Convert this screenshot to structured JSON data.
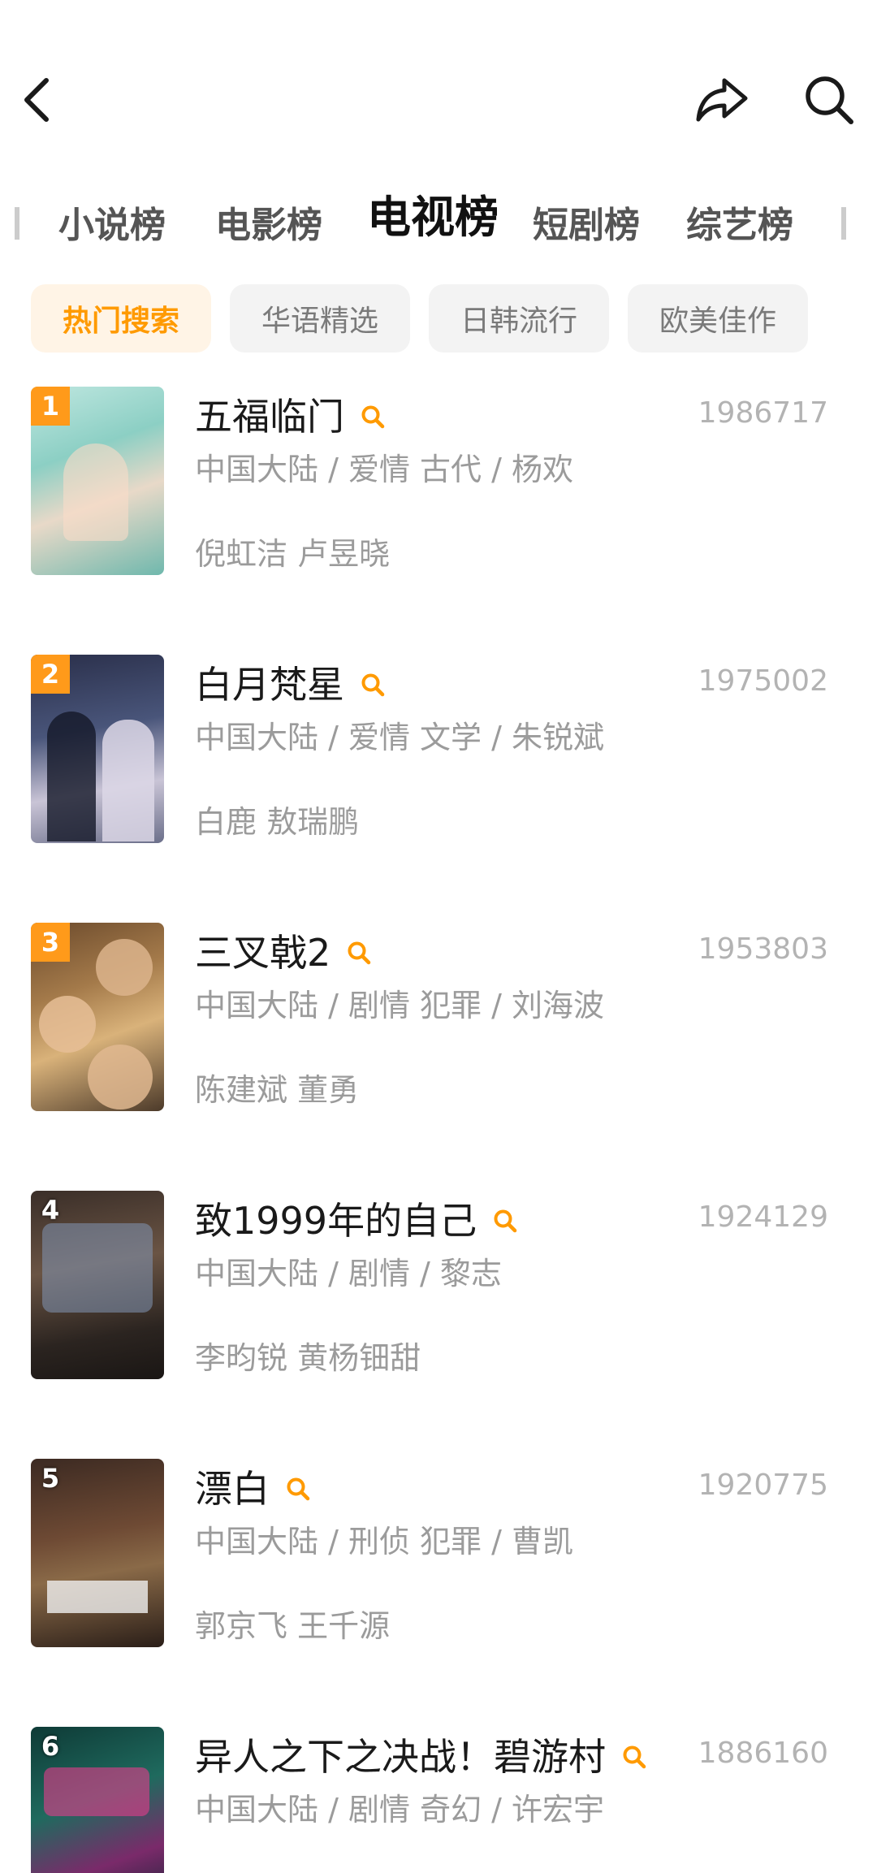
{
  "header": {
    "back_icon": "chevron-left-icon",
    "share_icon": "share-icon",
    "search_icon": "search-icon"
  },
  "category_tabs": [
    {
      "label": "小说榜",
      "active": false
    },
    {
      "label": "电影榜",
      "active": false
    },
    {
      "label": "电视榜",
      "active": true
    },
    {
      "label": "短剧榜",
      "active": false
    },
    {
      "label": "综艺榜",
      "active": false
    }
  ],
  "filter_chips": [
    {
      "label": "热门搜索",
      "active": true
    },
    {
      "label": "华语精选",
      "active": false
    },
    {
      "label": "日韩流行",
      "active": false
    },
    {
      "label": "欧美佳作",
      "active": false
    }
  ],
  "colors": {
    "accent": "#ff9a00",
    "rank_badge": "#ff9a1a",
    "chip_active_bg": "#fff4e6",
    "chip_bg": "#f3f3f3",
    "muted_text": "#9b9b9b",
    "score_text": "#b3b3b3"
  },
  "items": [
    {
      "rank": "1",
      "title": "五福临门",
      "score": "1986717",
      "meta": "中国大陆 / 爱情 古代 / 杨欢",
      "cast": "倪虹洁 卢昱晓"
    },
    {
      "rank": "2",
      "title": "白月梵星",
      "score": "1975002",
      "meta": "中国大陆 / 爱情 文学 / 朱锐斌",
      "cast": "白鹿 敖瑞鹏"
    },
    {
      "rank": "3",
      "title": "三叉戟2",
      "score": "1953803",
      "meta": "中国大陆 / 剧情 犯罪 / 刘海波",
      "cast": "陈建斌 董勇"
    },
    {
      "rank": "4",
      "title": "致1999年的自己",
      "score": "1924129",
      "meta": "中国大陆 / 剧情 / 黎志",
      "cast": "李昀锐 黄杨钿甜"
    },
    {
      "rank": "5",
      "title": "漂白",
      "score": "1920775",
      "meta": "中国大陆 / 刑侦 犯罪 / 曹凯",
      "cast": "郭京飞 王千源"
    },
    {
      "rank": "6",
      "title": "异人之下之决战！碧游村",
      "score": "1886160",
      "meta": "中国大陆 / 剧情 奇幻 / 许宏宇",
      "cast": ""
    }
  ]
}
